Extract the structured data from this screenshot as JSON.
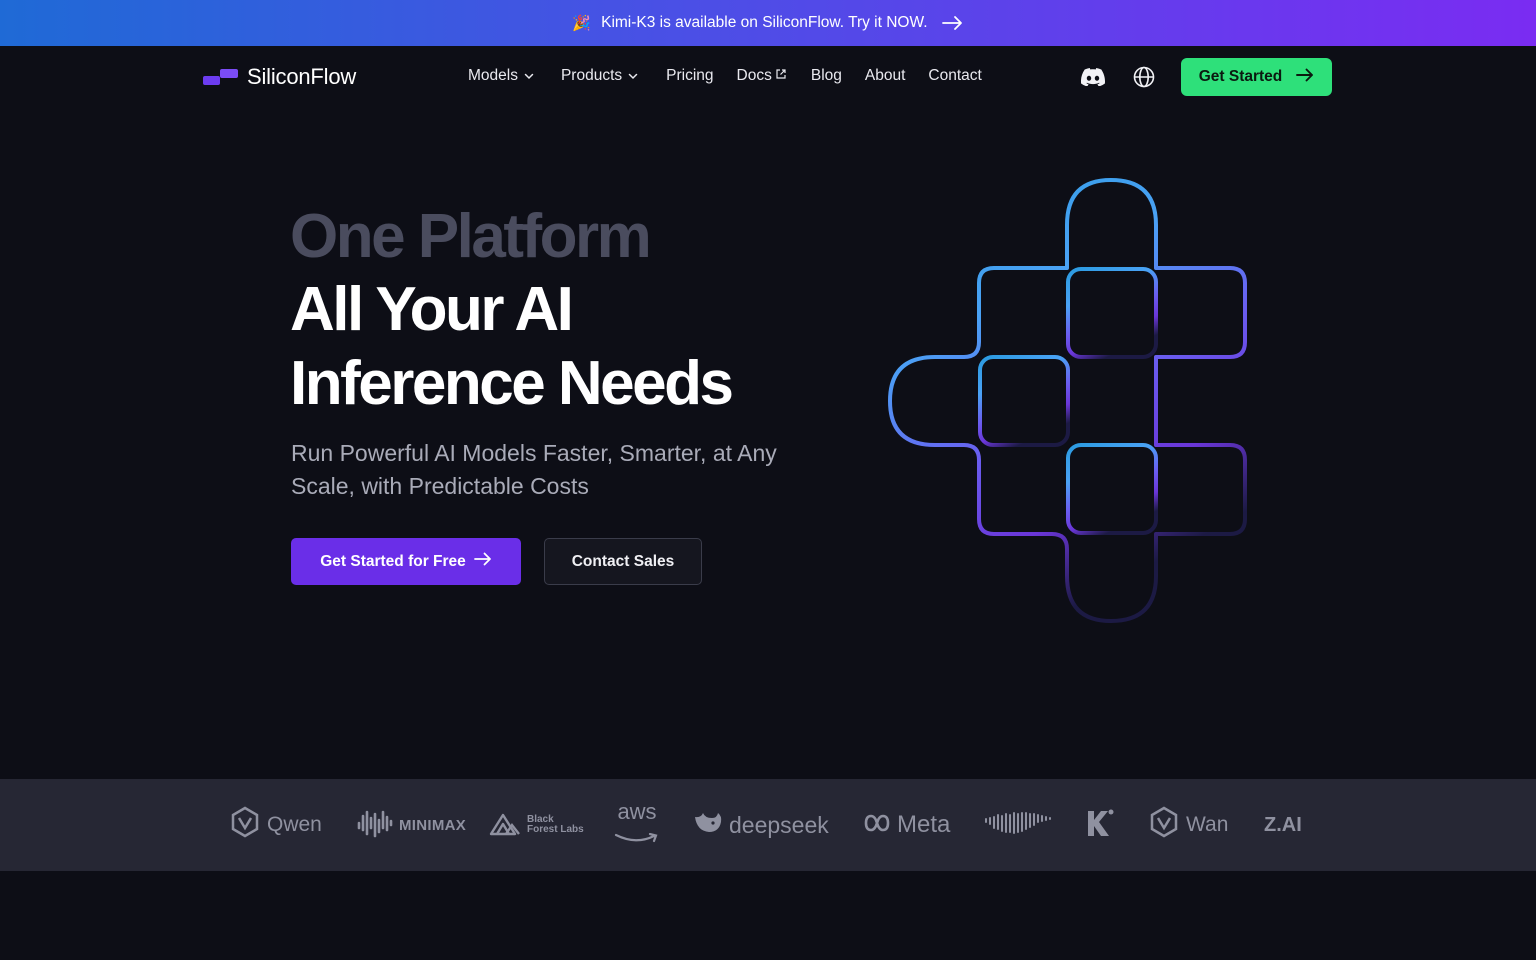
{
  "banner": {
    "emoji": "🎉",
    "text": "Kimi-K3 is available on SiliconFlow. Try it NOW."
  },
  "nav": {
    "logo_text": "SiliconFlow",
    "items": {
      "models": "Models",
      "products": "Products",
      "pricing": "Pricing",
      "docs": "Docs",
      "blog": "Blog",
      "about": "About",
      "contact": "Contact"
    },
    "cta_label": "Get Started",
    "icons": [
      "discord-icon",
      "globe-icon"
    ]
  },
  "hero": {
    "line1": "One Platform",
    "line2": "All Your AI",
    "line3": "Inference Needs",
    "subtitle": "Run Powerful AI Models Faster, Smarter, at Any Scale,  with Predictable Costs",
    "primary_cta": "Get Started for Free",
    "secondary_cta": "Contact Sales"
  },
  "partners": {
    "qwen": "Qwen",
    "minimax": "MINIMAX",
    "bfl_line1": "Black",
    "bfl_line2": "Forest Labs",
    "aws": "aws",
    "deepseek": "deepseek",
    "meta": "Meta",
    "wan": "Wan",
    "zai": "Z.AI"
  },
  "colors": {
    "accent_purple": "#6a2ee8",
    "cta_green": "#2ee07a",
    "background": "#0d0e16",
    "strip": "#262734"
  }
}
